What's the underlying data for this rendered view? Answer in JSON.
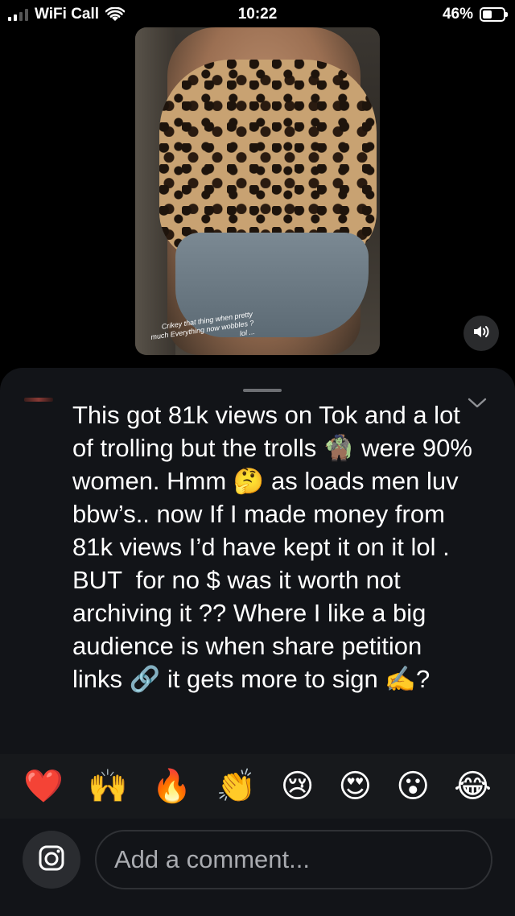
{
  "status_bar": {
    "carrier": "WiFi Call",
    "time": "10:22",
    "battery_percent": "46%",
    "battery_level": 0.46
  },
  "story": {
    "caption": "Crikey that thing when pretty much Everything now wobbles ? lol ...",
    "mute_icon": "speaker-muted-icon"
  },
  "comment": {
    "text": "This got 81k views on Tok and a lot of trolling but the trolls 🧌 were 90% women. Hmm 🤔 as loads men luv bbw’s.. now If I made money from 81k views I’d have kept it on it lol . BUT  for no $ was it worth not archiving it ?? Where I like a big audience is when share petition links 🔗 it gets more to sign ✍️?"
  },
  "reactions": [
    "❤️",
    "🙌",
    "🔥",
    "👏",
    "😢",
    "😍",
    "😮",
    "😂"
  ],
  "composer": {
    "placeholder": "Add a comment...",
    "camera_icon": "camera-icon"
  },
  "colors": {
    "background": "#000000",
    "sheet": "#121418",
    "emoji_bar": "#17191c",
    "placeholder_text": "#a9abb0"
  }
}
